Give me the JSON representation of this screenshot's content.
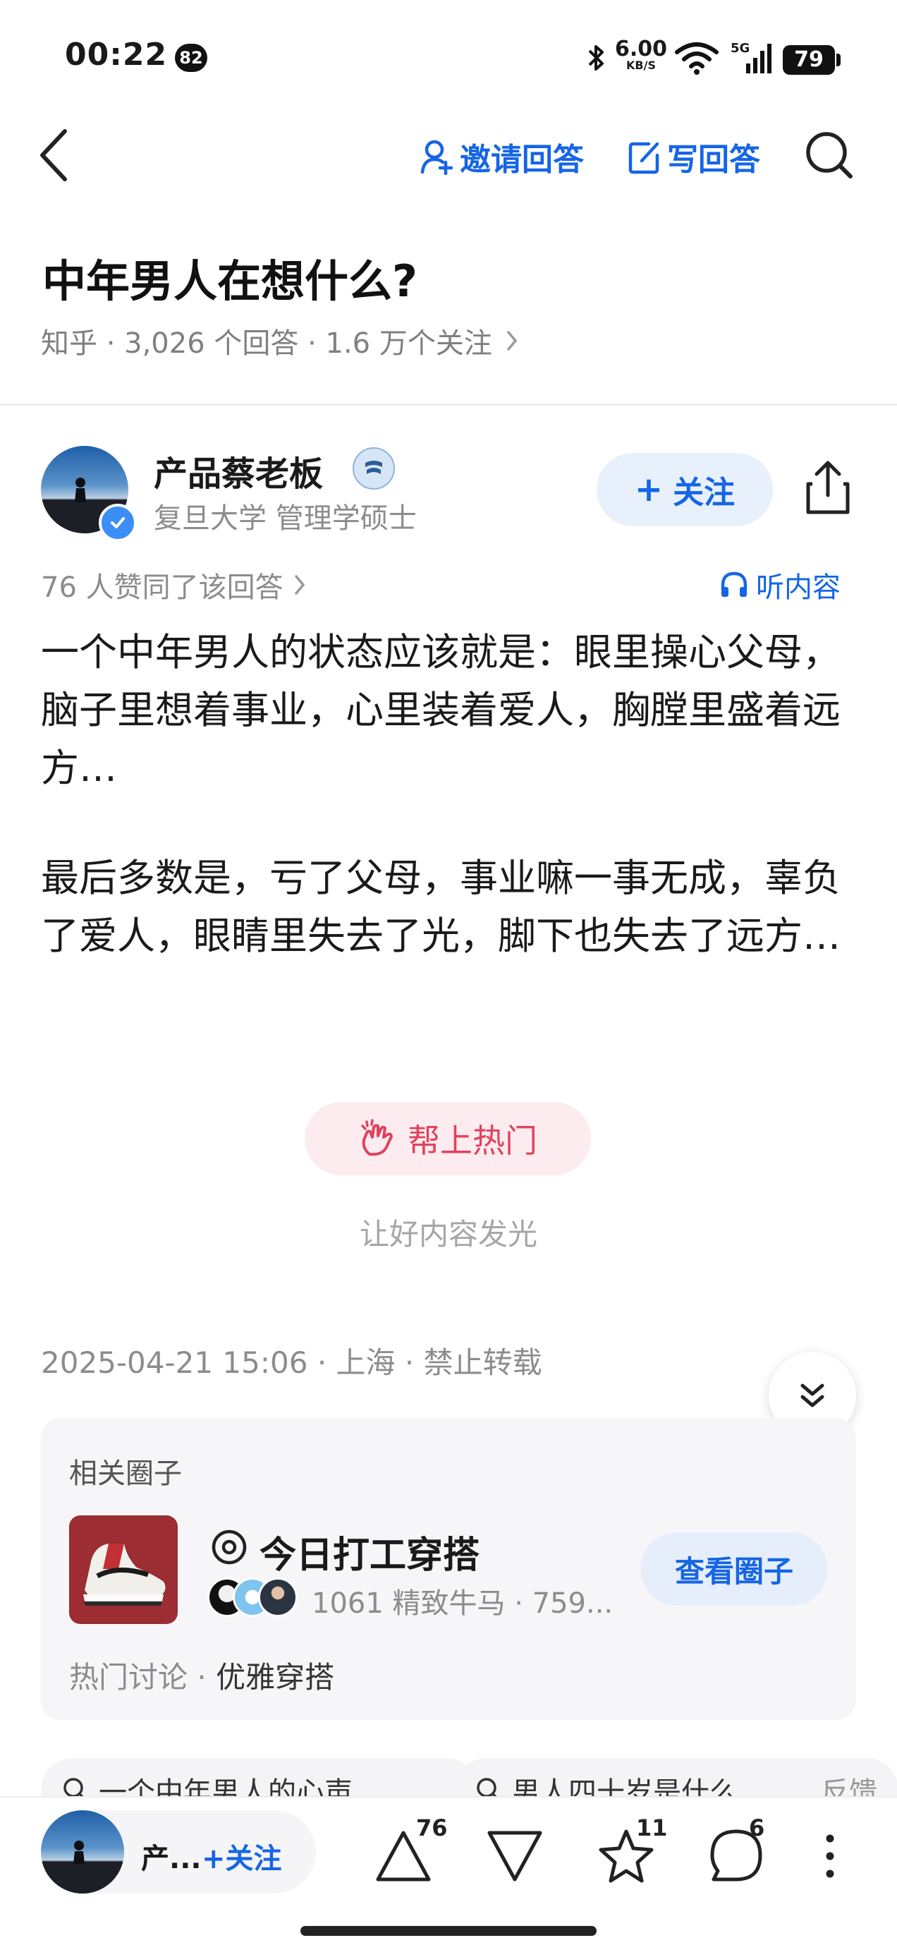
{
  "status": {
    "time": "00:22",
    "badge": "82",
    "speed_value": "6.00",
    "speed_unit": "KB/S",
    "network": "5G",
    "battery": "79"
  },
  "nav": {
    "invite_label": "邀请回答",
    "write_label": "写回答"
  },
  "question": {
    "title": "中年男人在想什么?",
    "meta": "知乎 · 3,026 个回答 · 1.6 万个关注"
  },
  "author": {
    "name": "产品蔡老板",
    "desc": "复旦大学 管理学硕士",
    "follow_label": "关注"
  },
  "answer": {
    "likes_line": "76 人赞同了该回答",
    "listen_label": "听内容",
    "paragraph1": "一个中年男人的状态应该就是：眼里操心父母，脑子里想着事业，心里装着爱人，胸膛里盛着远方…",
    "paragraph2": "最后多数是，亏了父母，事业嘛一事无成，辜负了爱人，眼睛里失去了光，脚下也失去了远方…",
    "boost_label": "帮上热门",
    "boost_sub": "让好内容发光",
    "post_meta": "2025-04-21 15:06 · 上海 · 禁止转载"
  },
  "circle": {
    "section_title": "相关圈子",
    "name": "今日打工穿搭",
    "stats": "1061 精致牛马 · 759...",
    "view_label": "查看圈子",
    "hot_prefix": "热门讨论 · ",
    "hot_topic": "优雅穿搭"
  },
  "related": [
    {
      "text": "一个中年男人的心声"
    },
    {
      "text": "男人四十岁是什么"
    }
  ],
  "related_extra": "反馈",
  "bottom": {
    "author_short": "产...",
    "follow_label": "关注",
    "upvotes": "76",
    "favorites": "11",
    "comments": "6"
  },
  "colors": {
    "accent": "#1565e6",
    "boost": "#e0435f"
  }
}
